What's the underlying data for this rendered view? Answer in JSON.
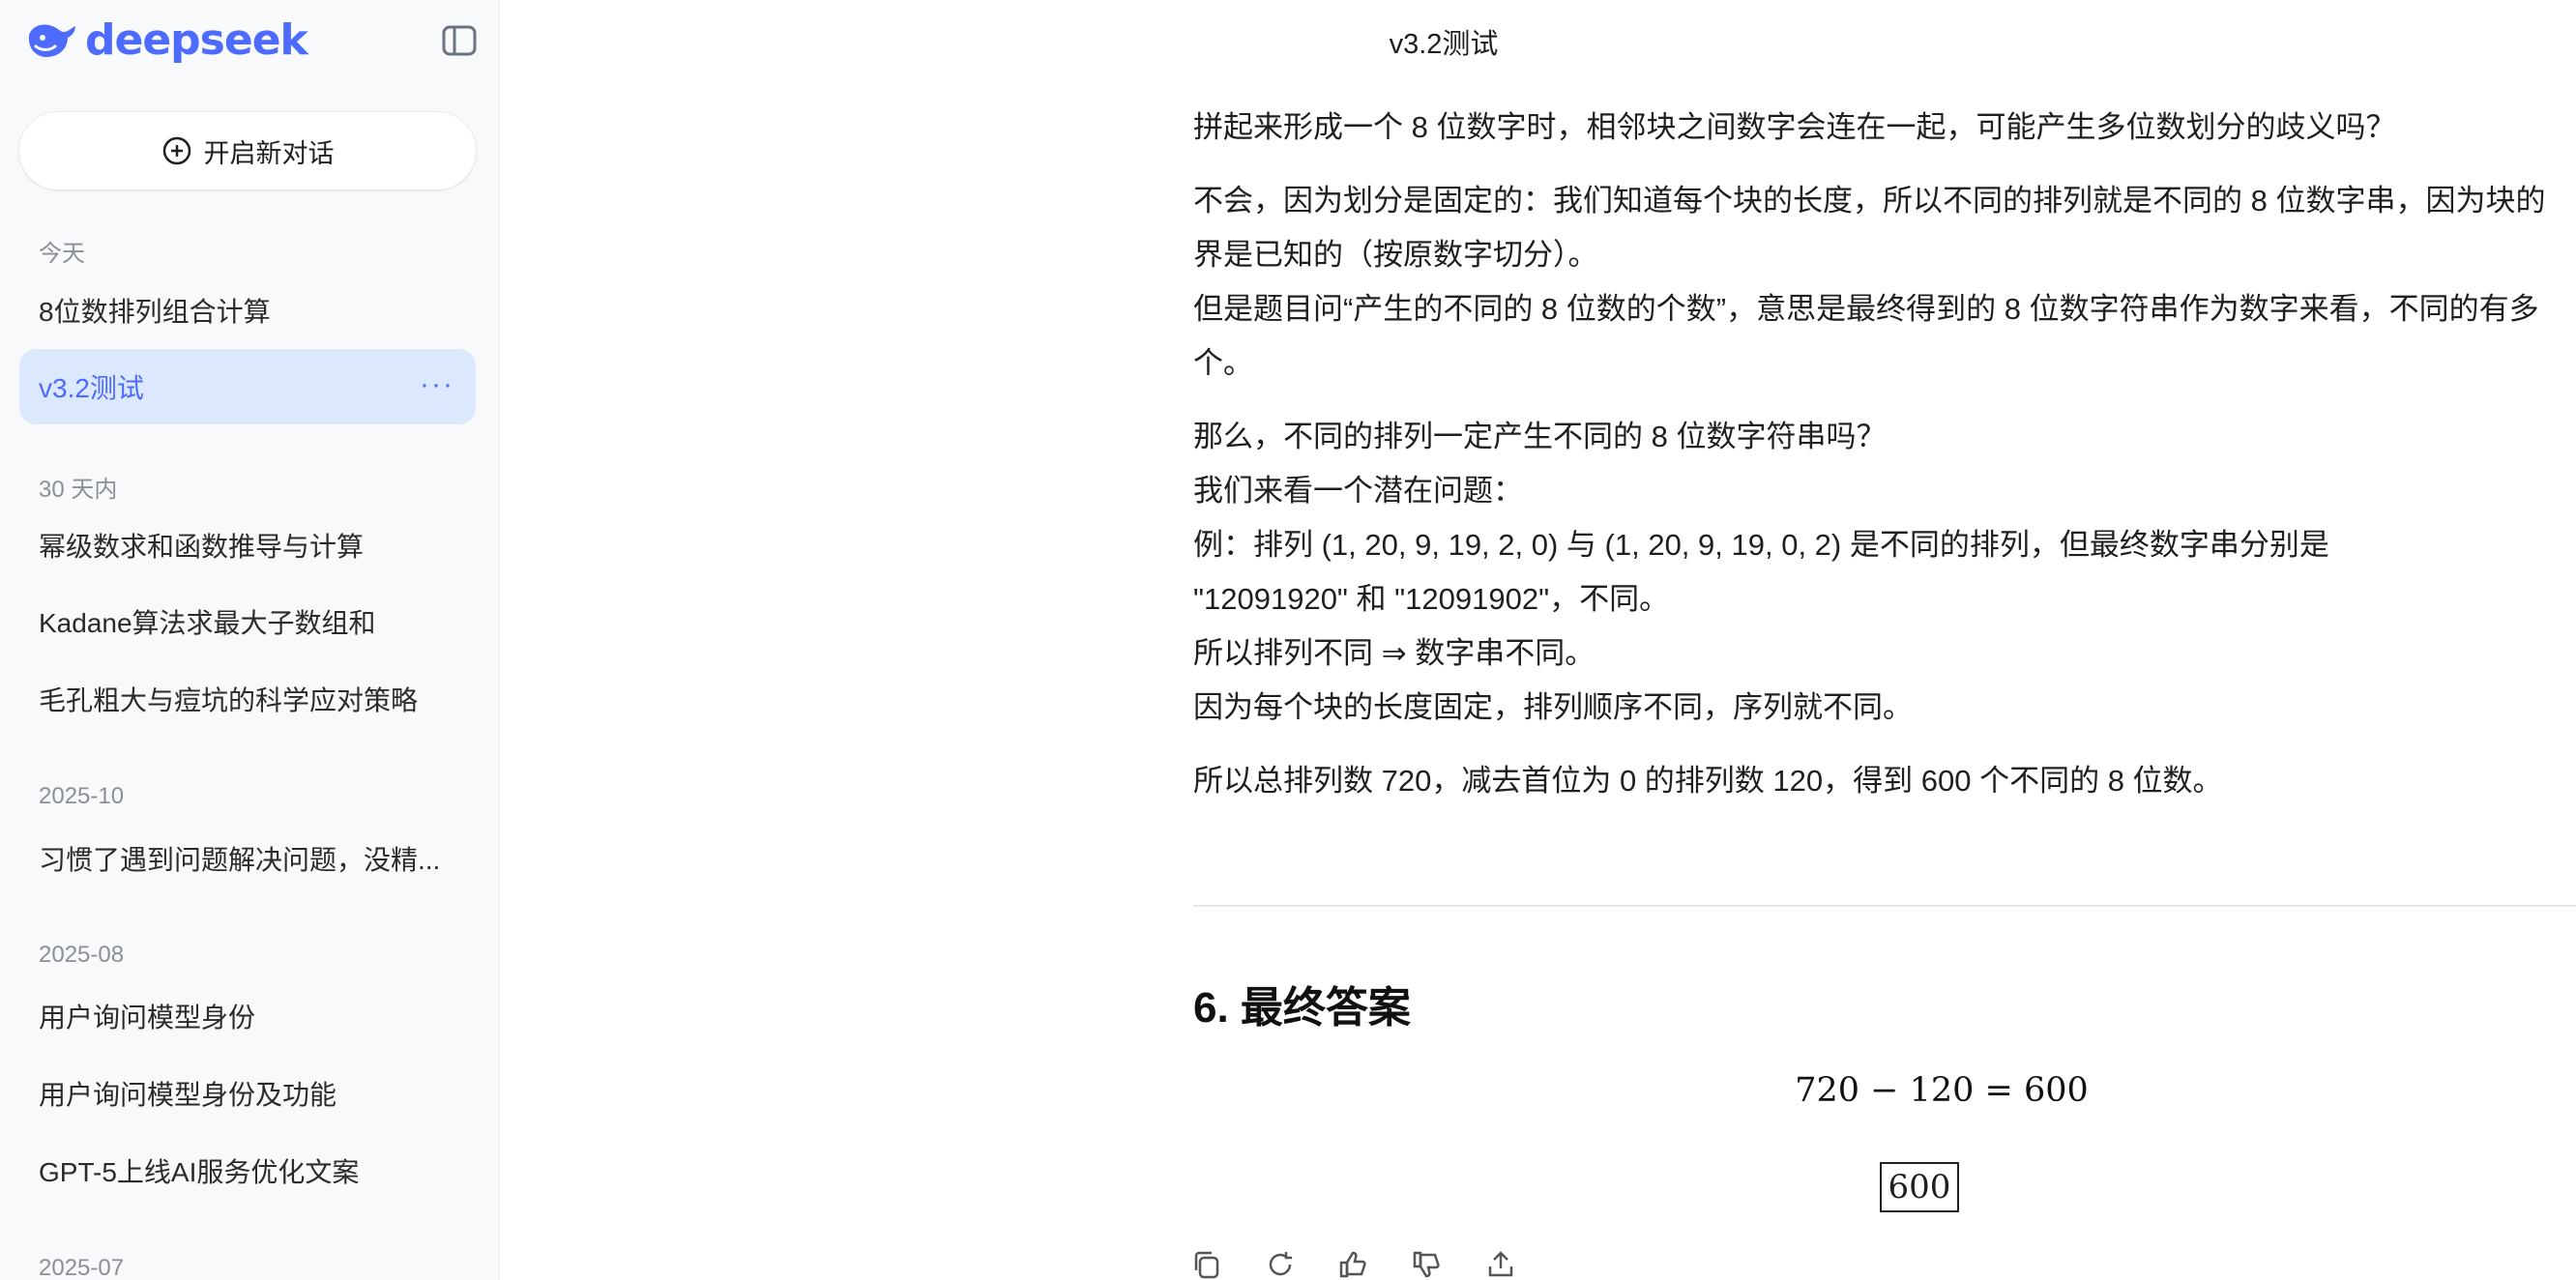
{
  "sidebar": {
    "brand": "deepseek",
    "new_chat_label": "开启新对话",
    "groups": [
      {
        "label": "今天",
        "items": [
          {
            "label": "8位数排列组合计算"
          },
          {
            "label": "v3.2测试",
            "active": true,
            "more": "···"
          }
        ]
      },
      {
        "label": "30 天内",
        "items": [
          {
            "label": "幂级数求和函数推导与计算"
          },
          {
            "label": "Kadane算法求最大子数组和"
          },
          {
            "label": "毛孔粗大与痘坑的科学应对策略"
          }
        ]
      },
      {
        "label": "2025-10",
        "items": [
          {
            "label": "习惯了遇到问题解决问题，没精..."
          }
        ]
      },
      {
        "label": "2025-08",
        "items": [
          {
            "label": "用户询问模型身份"
          },
          {
            "label": "用户询问模型身份及功能"
          },
          {
            "label": "GPT-5上线AI服务优化文案"
          }
        ]
      },
      {
        "label": "2025-07",
        "items": []
      }
    ]
  },
  "main": {
    "title": "v3.2测试",
    "paragraphs": [
      [
        "拼起来形成一个 8 位数字时，相邻块之间数字会连在一起，可能产生多位数划分的歧义吗？"
      ],
      [
        "不会，因为划分是固定的：我们知道每个块的长度，所以不同的排列就是不同的 8 位数字串，因为块的",
        "界是已知的（按原数字切分）。",
        "但是题目问“产生的不同的 8 位数的个数”，意思是最终得到的 8 位数字符串作为数字来看，不同的有多",
        "个。"
      ],
      [
        "那么，不同的排列一定产生不同的 8 位数字符串吗？",
        "我们来看一个潜在问题：",
        "例：排列 (1, 20, 9, 19, 2, 0) 与 (1, 20, 9, 19, 0, 2) 是不同的排列，但最终数字串分别是",
        "\"12091920\" 和 \"12091902\"，不同。",
        "所以排列不同 ⇒ 数字串不同。",
        "因为每个块的长度固定，排列顺序不同，序列就不同。"
      ],
      [
        "所以总排列数 720，减去首位为 0 的排列数 120，得到 600 个不同的 8 位数。"
      ]
    ],
    "heading": "6. 最终答案",
    "equation": "720 − 120 = 600",
    "boxed_answer": "600"
  },
  "colors": {
    "accent": "#4d6bfe",
    "active_bg": "#dbe8fd",
    "sidebar_bg": "#f8f9fb"
  },
  "icons": {
    "logo": "whale-logo-icon",
    "collapse": "sidebar-toggle-icon",
    "new_chat": "plus-circle-icon",
    "actions": [
      "copy-icon",
      "regenerate-icon",
      "thumbs-up-icon",
      "thumbs-down-icon",
      "share-icon"
    ]
  }
}
